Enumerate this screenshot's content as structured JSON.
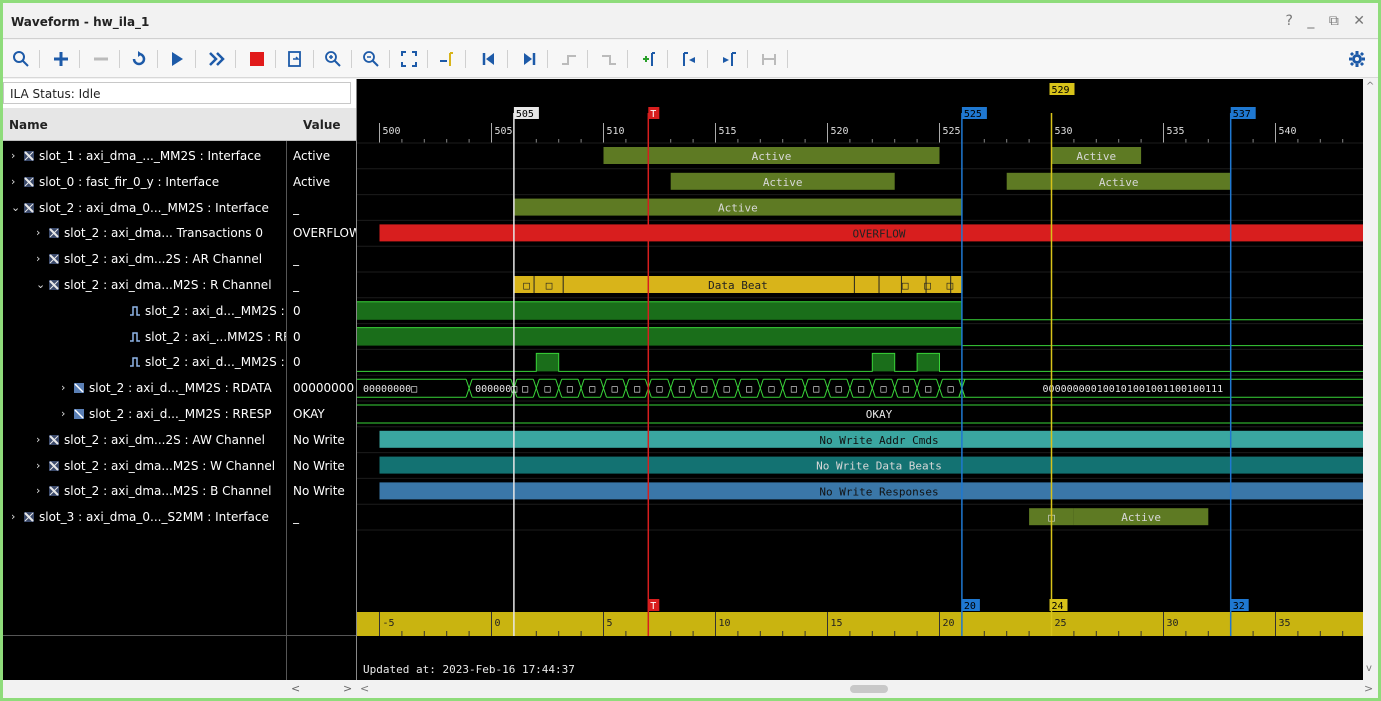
{
  "window": {
    "title": "Waveform - hw_ila_1",
    "controls": "? _ ⧉ ✕"
  },
  "toolbar": {
    "icons": [
      "search-icon",
      "add-icon",
      "remove-icon",
      "run-trigger-icon",
      "run-icon",
      "run-immediate-icon",
      "stop-icon",
      "export-icon",
      "zoom-in-icon",
      "zoom-out-icon",
      "zoom-fit-icon",
      "go-to-cursor-icon",
      "go-to-start-icon",
      "go-to-end-icon",
      "previous-transition-icon",
      "next-transition-icon",
      "add-marker-icon",
      "previous-marker-icon",
      "next-marker-icon",
      "swap-cursor-icon",
      "settings-icon"
    ]
  },
  "ila_status": "ILA Status: Idle",
  "columns": {
    "name": "Name",
    "value": "Value"
  },
  "signals": [
    {
      "level": 0,
      "expand": ">",
      "icon": "interface",
      "name": "slot_1 : axi_dma_..._MM2S : Interface",
      "value": "Active"
    },
    {
      "level": 0,
      "expand": ">",
      "icon": "interface",
      "name": "slot_0 : fast_fir_0_y : Interface",
      "value": "Active"
    },
    {
      "level": 0,
      "expand": "v",
      "icon": "interface",
      "name": "slot_2 : axi_dma_0..._MM2S : Interface",
      "value": "_"
    },
    {
      "level": 1,
      "expand": ">",
      "icon": "interface",
      "name": "slot_2 : axi_dma... Transactions 0",
      "value": "OVERFLOW"
    },
    {
      "level": 1,
      "expand": ">",
      "icon": "interface",
      "name": "slot_2 : axi_dm...2S : AR Channel",
      "value": "_"
    },
    {
      "level": 1,
      "expand": "v",
      "icon": "interface",
      "name": "slot_2 : axi_dma...M2S : R Channel",
      "value": "_"
    },
    {
      "level": 2,
      "expand": "",
      "icon": "bit",
      "name": "slot_2 : axi_d..._MM2S : RVALID",
      "value": "0"
    },
    {
      "level": 2,
      "expand": "",
      "icon": "bit",
      "name": "slot_2 : axi_...MM2S : RREADY",
      "value": "0"
    },
    {
      "level": 2,
      "expand": "",
      "icon": "bit",
      "name": "slot_2 : axi_d..._MM2S : RLAST",
      "value": "0"
    },
    {
      "level": 2,
      "expand": ">",
      "icon": "bus",
      "name": "slot_2 : axi_d..._MM2S : RDATA",
      "value": "00000000"
    },
    {
      "level": 2,
      "expand": ">",
      "icon": "bus",
      "name": "slot_2 : axi_d..._MM2S : RRESP",
      "value": "OKAY"
    },
    {
      "level": 1,
      "expand": ">",
      "icon": "interface",
      "name": "slot_2 : axi_dm...2S : AW Channel",
      "value": "No Write"
    },
    {
      "level": 1,
      "expand": ">",
      "icon": "interface",
      "name": "slot_2 : axi_dma...M2S : W Channel",
      "value": "No Write"
    },
    {
      "level": 1,
      "expand": ">",
      "icon": "interface",
      "name": "slot_2 : axi_dma...M2S : B Channel",
      "value": "No Write"
    },
    {
      "level": 0,
      "expand": ">",
      "icon": "interface",
      "name": "slot_3 : axi_dma_0..._S2MM : Interface",
      "value": "_"
    }
  ],
  "timeline": {
    "ruler_labels": [
      "500",
      "505",
      "510",
      "515",
      "520",
      "525",
      "530",
      "535",
      "540"
    ],
    "sample_labels": [
      "-5",
      "0",
      "5",
      "10",
      "15",
      "20",
      "25",
      "30",
      "35"
    ],
    "markers": [
      {
        "label": "505",
        "color": "#e8e8e8",
        "bottom": ""
      },
      {
        "label": "T",
        "color": "#d81e1e",
        "bottom": "T"
      },
      {
        "label": "525",
        "color": "#1f78d1",
        "bottom": "20"
      },
      {
        "label": "529",
        "color": "#d8c31a",
        "bottom": "24"
      },
      {
        "label": "537",
        "color": "#1f78d1",
        "bottom": "32"
      }
    ],
    "updated": "Updated at: 2023-Feb-16 17:44:37"
  },
  "wave_labels": {
    "active": "Active",
    "overflow": "OVERFLOW",
    "data_beat": "Data Beat",
    "beat_mark": "□",
    "rdata_start": "00000000□",
    "rdata_second": "000000□",
    "rdata_end": "000000000100101001001100100111",
    "okay": "OKAY",
    "no_write_addr": "No Write Addr Cmds",
    "no_write_data": "No Write Data Beats",
    "no_write_resp": "No Write Responses"
  },
  "scroll": {
    "left": "<",
    "right": ">",
    "up": "^",
    "down": "v"
  },
  "colors": {
    "active": "#5e7a23",
    "overflow": "#d81e1e",
    "databeat": "#d8b41a",
    "signal_green": "#1a6e1a",
    "teal": "#3aa6a0",
    "teal_dark": "#137272",
    "steel": "#3a77a8",
    "ruler_gold": "#c9b410"
  }
}
